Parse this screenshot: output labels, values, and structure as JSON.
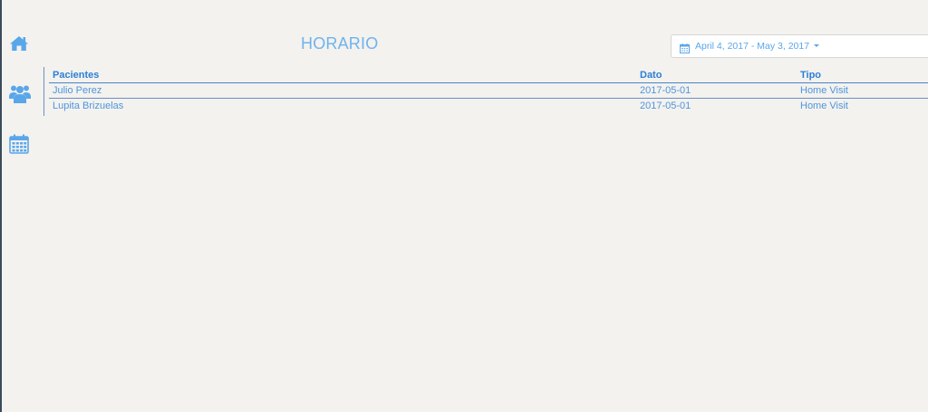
{
  "sidebar": {
    "items": [
      {
        "icon": "home-icon"
      },
      {
        "icon": "users-icon"
      },
      {
        "icon": "calendar-icon"
      }
    ],
    "icon_color": "#5aa6ea"
  },
  "header": {
    "title": "HORARIO",
    "date_range": "April 4, 2017 - May 3, 2017"
  },
  "table": {
    "columns": [
      "Pacientes",
      "Dato",
      "Tipo"
    ],
    "rows": [
      [
        "Julio Perez",
        "2017-05-01",
        "Home Visit"
      ],
      [
        "Lupita Brizuelas",
        "2017-05-01",
        "Home Visit"
      ]
    ]
  },
  "colors": {
    "background": "#f3f2ee",
    "accent": "#5aa6ea",
    "header_text": "#2c7fd8"
  }
}
